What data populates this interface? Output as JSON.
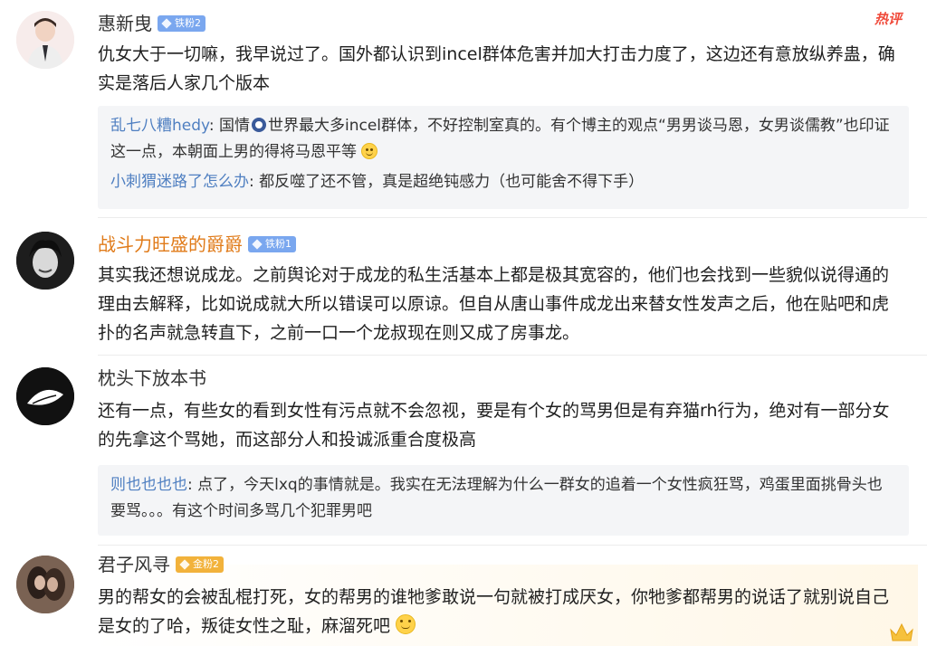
{
  "hot_label": "热评",
  "comments": [
    {
      "name": "惠新曳",
      "badge": "铁粉2",
      "text": "仇女大于一切嘛，我早说过了。国外都认识到incel群体危害并加大打击力度了，这边还有意放纵养蛊，确实是落后人家几个版本",
      "replies": [
        {
          "name": "乱七八糟hedy",
          "text_before": ": 国情",
          "icon": "laugh-emoji",
          "text_after": "世界最大多incel群体，不好控制室真的。有个博主的观点“男男谈马恩，女男谈儒教”也印证这一点，本朝面上男的得将马恩平等"
        },
        {
          "name": "小刺猬迷路了怎么办",
          "text": ": 都反噬了还不管，真是超绝钝感力（也可能舍不得下手）"
        }
      ]
    },
    {
      "name": "战斗力旺盛的爵爵",
      "badge": "铁粉1",
      "text": "其实我还想说成龙。之前舆论对于成龙的私生活基本上都是极其宽容的，他们也会找到一些貌似说得通的理由去解释，比如说成就大所以错误可以原谅。但自从唐山事件成龙出来替女性发声之后，他在贴吧和虎扑的名声就急转直下，之前一口一个龙叔现在则又成了房事龙。"
    },
    {
      "name": "枕头下放本书",
      "text": "还有一点，有些女的看到女性有污点就不会忽视，要是有个女的骂男但是有弃猫rh行为，绝对有一部分女的先拿这个骂她，而这部分人和投诚派重合度极高",
      "replies": [
        {
          "name": "则也也也也",
          "text": ": 点了，今天lxq的事情就是。我实在无法理解为什么一群女的追着一个女性疯狂骂，鸡蛋里面挑骨头也要骂。。。有这个时间多骂几个犯罪男吧"
        }
      ]
    },
    {
      "name": "君子风寻",
      "badge": "金粉2",
      "text": "男的帮女的会被乱棍打死，女的帮男的谁牠爹敢说一句就被打成厌女，你牠爹都帮男的说话了就别说自己是女的了哈，叛徒女性之耻，麻溜死吧"
    }
  ]
}
